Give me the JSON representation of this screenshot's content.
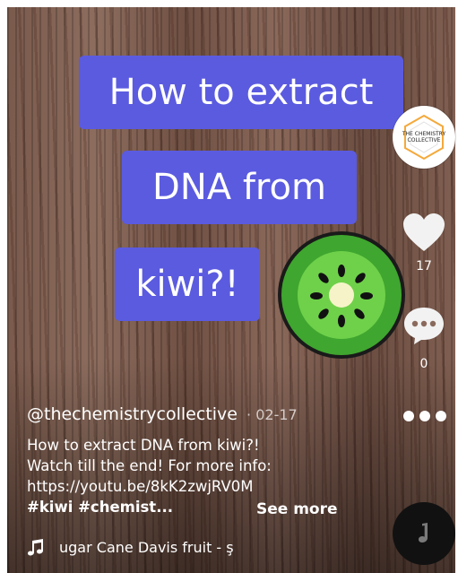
{
  "video": {
    "caption_lines": [
      "How to extract",
      "DNA from",
      "kiwi?!"
    ]
  },
  "creator": {
    "avatar_text_line1": "THE CHEMISTRY",
    "avatar_text_line2": "COLLECTIVE",
    "handle": "@thechemistrycollective",
    "date": "· 02-17"
  },
  "actions": {
    "like_count": "17",
    "comment_count": "0",
    "like_icon": "heart-icon",
    "comment_icon": "comment-bubble-icon",
    "share_icon": "more-dots-icon"
  },
  "description": {
    "line1": "How to extract DNA from kiwi?!",
    "line2": "Watch till the end! For more info:",
    "line3": "https://youtu.be/8kK2zwjRV0M",
    "tags": "#kiwi #chemist...",
    "see_more": "See more"
  },
  "music": {
    "icon": "music-note-icon",
    "text": "ugar Cane Davis    fruit - ş"
  },
  "colors": {
    "caption_bg": "#5b5be0",
    "kiwi_green": "#3fa62f"
  }
}
